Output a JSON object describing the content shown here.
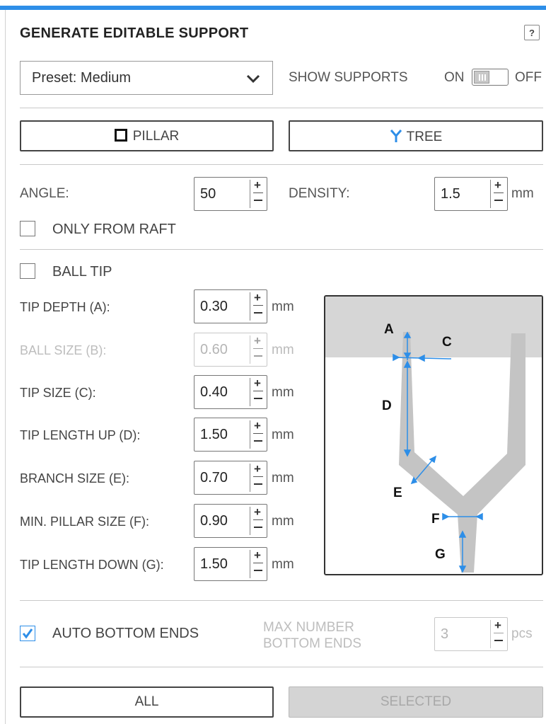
{
  "header": {
    "title": "GENERATE EDITABLE SUPPORT",
    "help": "?"
  },
  "preset": {
    "value": "Preset: Medium"
  },
  "show_supports": {
    "label": "SHOW SUPPORTS",
    "on": "ON",
    "off": "OFF",
    "state": "on"
  },
  "type_buttons": {
    "pillar": "PILLAR",
    "tree": "TREE",
    "pillar_icon": "square-outline-icon",
    "tree_icon": "y-branch-icon",
    "accent": "#2d8ee8"
  },
  "angle": {
    "label": "ANGLE:",
    "value": "50"
  },
  "density": {
    "label": "DENSITY:",
    "value": "1.5",
    "unit": "mm"
  },
  "only_from_raft": {
    "label": "ONLY FROM RAFT",
    "checked": false
  },
  "ball_tip": {
    "label": "BALL TIP",
    "checked": false
  },
  "params": [
    {
      "label": "TIP DEPTH (A):",
      "value": "0.30",
      "unit": "mm",
      "disabled": false
    },
    {
      "label": "BALL SIZE (B):",
      "value": "0.60",
      "unit": "mm",
      "disabled": true
    },
    {
      "label": "TIP SIZE (C):",
      "value": "0.40",
      "unit": "mm",
      "disabled": false
    },
    {
      "label": "TIP LENGTH UP (D):",
      "value": "1.50",
      "unit": "mm",
      "disabled": false
    },
    {
      "label": "BRANCH SIZE (E):",
      "value": "0.70",
      "unit": "mm",
      "disabled": false
    },
    {
      "label": "MIN. PILLAR SIZE (F):",
      "value": "0.90",
      "unit": "mm",
      "disabled": false
    },
    {
      "label": "TIP LENGTH DOWN (G):",
      "value": "1.50",
      "unit": "mm",
      "disabled": false
    }
  ],
  "diagram": {
    "labels": [
      "A",
      "C",
      "D",
      "E",
      "F",
      "G"
    ]
  },
  "auto_bottom_ends": {
    "label": "AUTO BOTTOM ENDS",
    "checked": true
  },
  "max_bottom_ends": {
    "label_line1": "MAX NUMBER",
    "label_line2": "BOTTOM ENDS",
    "value": "3",
    "unit": "pcs",
    "disabled": true
  },
  "actions": {
    "all": "ALL",
    "selected": "SELECTED"
  }
}
